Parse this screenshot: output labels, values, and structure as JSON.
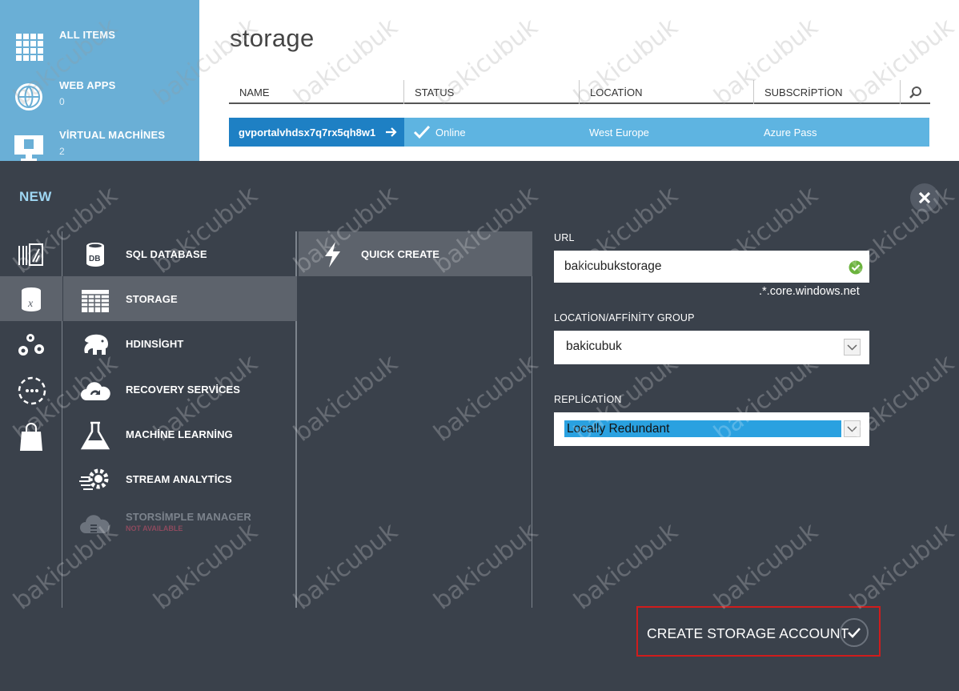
{
  "left_nav": {
    "items": [
      {
        "label": "ALL ITEMS",
        "count": "",
        "icon": "grid-icon"
      },
      {
        "label": "WEB APPS",
        "count": "0",
        "icon": "globe-icon"
      },
      {
        "label": "VİRTUAL MACHİNES",
        "count": "2",
        "icon": "monitor-icon"
      }
    ]
  },
  "page": {
    "title": "storage"
  },
  "grid": {
    "columns": [
      "NAME",
      "STATUS",
      "LOCATİON",
      "SUBSCRİPTİON"
    ],
    "rows": [
      {
        "name": "gvportalvhdsx7q7rx5qh8w1",
        "status": "Online",
        "location": "West Europe",
        "subscription": "Azure Pass"
      }
    ]
  },
  "dialog": {
    "title": "NEW",
    "services": [
      {
        "label": "SQL DATABASE",
        "icon": "db-icon"
      },
      {
        "label": "STORAGE",
        "icon": "storage-table-icon",
        "selected": true
      },
      {
        "label": "HDINSİGHT",
        "icon": "elephant-icon"
      },
      {
        "label": "RECOVERY SERVİCES",
        "icon": "cloud-icon"
      },
      {
        "label": "MACHİNE LEARNİNG",
        "icon": "flask-icon"
      },
      {
        "label": "STREAM ANALYTİCS",
        "icon": "gear-stream-icon"
      },
      {
        "label": "STORSİMPLE MANAGER",
        "sublabel": "NOT AVAILABLE",
        "icon": "storsimple-icon",
        "disabled": true
      }
    ],
    "options": [
      {
        "label": "QUICK CREATE",
        "icon": "lightning-icon"
      }
    ],
    "form": {
      "url_label": "URL",
      "url_value": "bakicubukstorage",
      "url_suffix": ".*.core.windows.net",
      "location_label": "LOCATİON/AFFİNİTY GROUP",
      "location_value": "bakicubuk",
      "replication_label": "REPLİCATİON",
      "replication_value": "Locally Redundant"
    },
    "create_button": "CREATE STORAGE ACCOUNT"
  },
  "watermark": "bakicubuk",
  "colors": {
    "nav_blue": "#6aafd6",
    "row_blue": "#5eb4e1",
    "row_name_blue": "#1e80c4",
    "dialog_bg": "#3a414b",
    "highlight_red": "#d01c1c"
  }
}
